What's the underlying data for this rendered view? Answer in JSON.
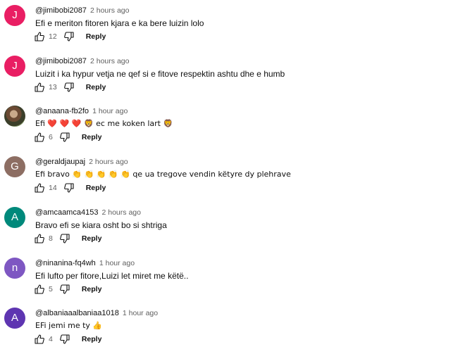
{
  "ui": {
    "reply_label": "Reply"
  },
  "comments": [
    {
      "avatar_letter": "J",
      "avatar_color": "#e91e63",
      "handle": "@jimibobi2087",
      "time": "2 hours ago",
      "text": "Efi e meriton fitoren kjara e ka bere luizin lolo",
      "likes": "12"
    },
    {
      "avatar_letter": "J",
      "avatar_color": "#e91e63",
      "handle": "@jimibobi2087",
      "time": "2 hours ago",
      "text": "Luizit i ka hypur vetja ne qef si e fitove respektin ashtu dhe e humb",
      "likes": "13"
    },
    {
      "avatar_letter": "",
      "avatar_color": "#5c5a3e",
      "handle": "@anaana-fb2fo",
      "time": "1 hour ago",
      "text": "Efi ❤️ ❤️ ❤️ 🦁 ec me koken lart 🦁",
      "likes": "6"
    },
    {
      "avatar_letter": "G",
      "avatar_color": "#8d6e63",
      "handle": "@geraldjaupaj",
      "time": "2 hours ago",
      "text": "Efi bravo 👏 👏 👏 👏 👏  qe ua tregove vendin këtyre dy plehrave",
      "likes": "14"
    },
    {
      "avatar_letter": "A",
      "avatar_color": "#00897b",
      "handle": "@amcaamca4153",
      "time": "2 hours ago",
      "text": "Bravo  efi se  kiara  osht  bo  si  shtriga",
      "likes": "8"
    },
    {
      "avatar_letter": "n",
      "avatar_color": "#7e57c2",
      "handle": "@ninanina-fq4wh",
      "time": "1 hour ago",
      "text": "Efi lufto per fitore,Luizi let miret me këtë..",
      "likes": "5"
    },
    {
      "avatar_letter": "A",
      "avatar_color": "#5e35b1",
      "handle": "@albaniaaalbaniaa1018",
      "time": "1 hour ago",
      "text": "EFi  jemi  me ty  👍",
      "likes": "4"
    }
  ]
}
